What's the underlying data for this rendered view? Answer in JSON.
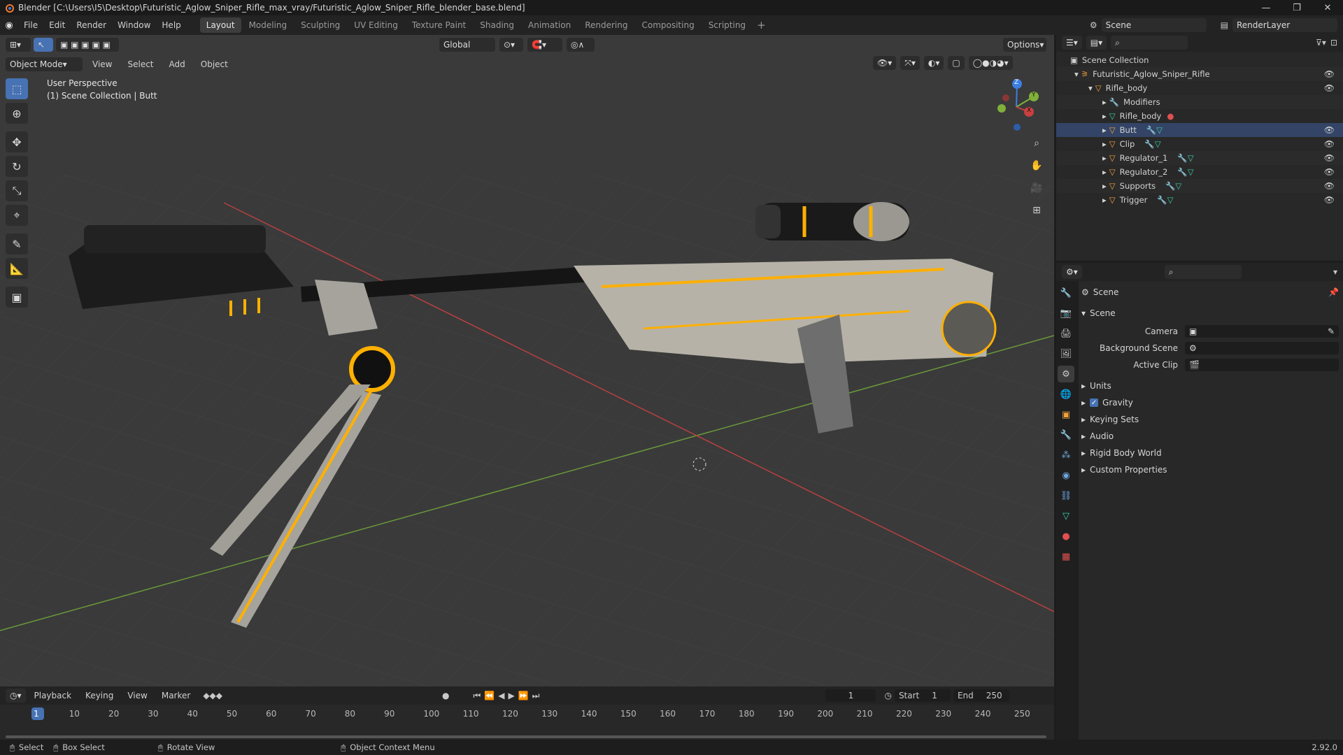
{
  "window": {
    "title": "Blender [C:\\Users\\I5\\Desktop\\Futuristic_Aglow_Sniper_Rifle_max_vray/Futuristic_Aglow_Sniper_Rifle_blender_base.blend]"
  },
  "menu": [
    "File",
    "Edit",
    "Render",
    "Window",
    "Help"
  ],
  "workspaces": [
    "Layout",
    "Modeling",
    "Sculpting",
    "UV Editing",
    "Texture Paint",
    "Shading",
    "Animation",
    "Rendering",
    "Compositing",
    "Scripting"
  ],
  "active_workspace": "Layout",
  "scene_selector": "Scene",
  "render_layer": "RenderLayer",
  "viewport": {
    "transform_orientation": "Global",
    "options_label": "Options",
    "mode": "Object Mode",
    "header_menu": [
      "View",
      "Select",
      "Add",
      "Object"
    ],
    "overlay_line1": "User Perspective",
    "overlay_line2": "(1) Scene Collection | Butt",
    "gizmo_axes": [
      "Z",
      "Y",
      "X"
    ]
  },
  "outliner": {
    "root": "Scene Collection",
    "collection": "Futuristic_Aglow_Sniper_Rifle",
    "parent": "Rifle_body",
    "items": [
      {
        "label": "Modifiers",
        "icon": "wrench-icon"
      },
      {
        "label": "Rifle_body",
        "icon": "mesh-icon"
      },
      {
        "label": "Butt",
        "icon": "object-icon"
      },
      {
        "label": "Clip",
        "icon": "object-icon"
      },
      {
        "label": "Regulator_1",
        "icon": "object-icon"
      },
      {
        "label": "Regulator_2",
        "icon": "object-icon"
      },
      {
        "label": "Supports",
        "icon": "object-icon"
      },
      {
        "label": "Trigger",
        "icon": "object-icon"
      }
    ]
  },
  "properties": {
    "header": "Scene",
    "section": "Scene",
    "camera_label": "Camera",
    "background_scene_label": "Background Scene",
    "active_clip_label": "Active Clip",
    "panels": [
      "Units",
      "Gravity",
      "Keying Sets",
      "Audio",
      "Rigid Body World",
      "Custom Properties"
    ],
    "gravity_checked": true
  },
  "timeline": {
    "menus": [
      "Playback",
      "Keying",
      "View",
      "Marker"
    ],
    "current_frame": "1",
    "start_label": "Start",
    "start": "1",
    "end_label": "End",
    "end": "250",
    "ticks": [
      "1",
      "10",
      "20",
      "30",
      "40",
      "50",
      "60",
      "70",
      "80",
      "90",
      "100",
      "110",
      "120",
      "130",
      "140",
      "150",
      "160",
      "170",
      "180",
      "190",
      "200",
      "210",
      "220",
      "230",
      "240",
      "250"
    ]
  },
  "status": {
    "select": "Select",
    "box_select": "Box Select",
    "rotate_view": "Rotate View",
    "context_menu": "Object Context Menu",
    "version": "2.92.0"
  },
  "colors": {
    "accent": "#4772b3",
    "glow": "#ffb000",
    "x_axis": "#c94040",
    "y_axis": "#7fb03a",
    "z_axis": "#3b7fe0"
  }
}
